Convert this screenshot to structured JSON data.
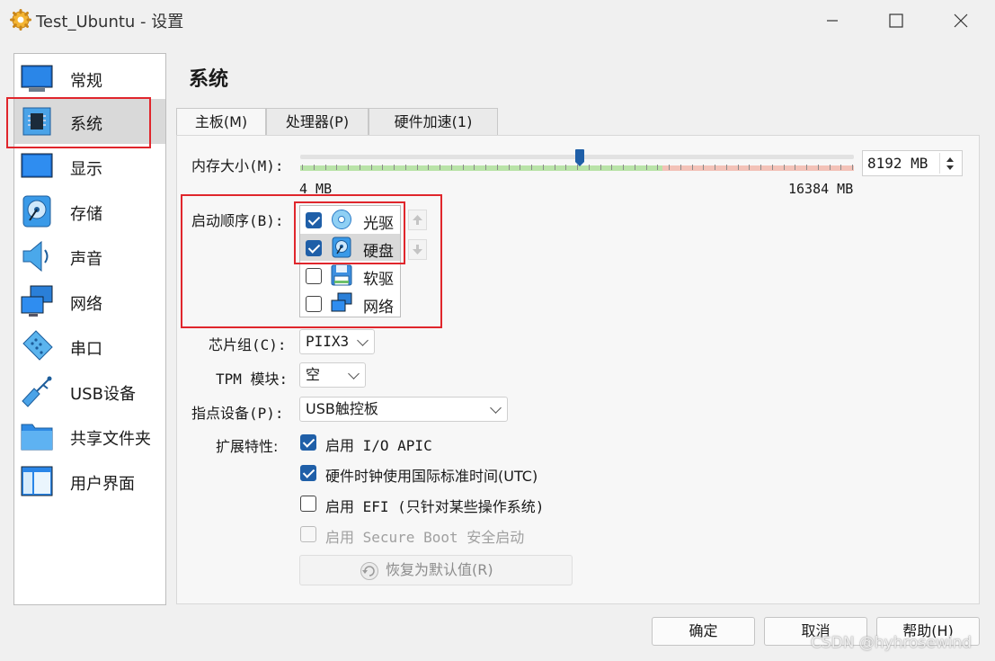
{
  "window": {
    "title": "Test_Ubuntu - 设置"
  },
  "sidebar": {
    "items": [
      {
        "label": "常规"
      },
      {
        "label": "系统"
      },
      {
        "label": "显示"
      },
      {
        "label": "存储"
      },
      {
        "label": "声音"
      },
      {
        "label": "网络"
      },
      {
        "label": "串口"
      },
      {
        "label": "USB设备"
      },
      {
        "label": "共享文件夹"
      },
      {
        "label": "用户界面"
      }
    ],
    "selected": "系统"
  },
  "page": {
    "title": "系统"
  },
  "tabs": [
    {
      "label": "主板(M)",
      "active": true
    },
    {
      "label": "处理器(P)",
      "active": false
    },
    {
      "label": "硬件加速(1)",
      "active": false
    }
  ],
  "memory": {
    "label": "内存大小(M):",
    "value": "8192 MB",
    "min_label": "4 MB",
    "max_label": "16384 MB",
    "slider_fraction": 0.5
  },
  "boot": {
    "label": "启动顺序(B):",
    "items": [
      {
        "label": "光驱",
        "checked": true
      },
      {
        "label": "硬盘",
        "checked": true
      },
      {
        "label": "软驱",
        "checked": false
      },
      {
        "label": "网络",
        "checked": false
      }
    ]
  },
  "chipset": {
    "label": "芯片组(C):",
    "value": "PIIX3"
  },
  "tpm": {
    "label": "TPM 模块:",
    "value": "空"
  },
  "pointing": {
    "label": "指点设备(P):",
    "value": "USB触控板"
  },
  "features": {
    "label": "扩展特性:",
    "options": [
      {
        "label": "启用 I/O APIC",
        "checked": true,
        "disabled": false
      },
      {
        "label": "硬件时钟使用国际标准时间(UTC)",
        "checked": true,
        "disabled": false
      },
      {
        "label": "启用 EFI (只针对某些操作系统)",
        "checked": false,
        "disabled": false
      },
      {
        "label": "启用 Secure Boot 安全启动",
        "checked": false,
        "disabled": true
      }
    ]
  },
  "restore_button": "恢复为默认值(R)",
  "footer": {
    "ok": "确定",
    "cancel": "取消",
    "help": "帮助(H)"
  },
  "watermark": "CSDN @hyhrosewind",
  "colors": {
    "accent": "#1f5fa8",
    "highlight_box": "#e0262c",
    "slider_green": "#b9e3a8",
    "slider_red": "#f3c2b8"
  }
}
